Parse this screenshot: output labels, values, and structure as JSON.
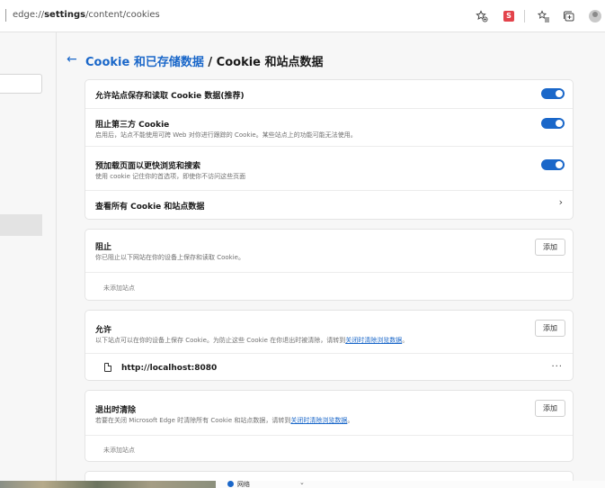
{
  "address_bar": {
    "url_prefix": "edge://",
    "url_bold": "settings",
    "url_rest": "/content/cookies",
    "ext_badge": "S"
  },
  "header": {
    "back_arrow": "←",
    "title_link": "Cookie 和已存储数据",
    "title_sep": " / ",
    "title_current": "Cookie 和站点数据"
  },
  "settings": {
    "allow_save_label": "允许站点保存和读取 Cookie 数据(推荐)",
    "block_third_label": "阻止第三方 Cookie",
    "block_third_desc": "启用后，站点不能使用可跨 Web 对你进行跟踪的 Cookie。某些站点上的功能可能无法使用。",
    "preload_label": "预加载页面以更快浏览和搜索",
    "preload_desc": "使用 cookie 记住你的首选项，即使你不访问这些页面",
    "see_all_label": "查看所有 Cookie 和站点数据",
    "chevron": "›"
  },
  "block_section": {
    "title": "阻止",
    "desc": "你已阻止以下网站在你的设备上保存和读取 Cookie。",
    "add": "添加",
    "empty": "未添加站点"
  },
  "allow_section": {
    "title": "允许",
    "desc_prefix": "以下站点可以在你的设备上保存 Cookie。为防止这些 Cookie 在你退出时被清除，请转到",
    "desc_link": "关闭时清除浏览数据",
    "desc_suffix": "。",
    "add": "添加",
    "site": "http://localhost:8080",
    "more": "···"
  },
  "clear_section": {
    "title": "退出时清除",
    "desc_prefix": "若要在关闭 Microsoft Edge 时清除所有 Cookie 和站点数据，请转到",
    "desc_link": "关闭时清除浏览数据",
    "desc_suffix": "。",
    "add": "添加",
    "empty": "未添加站点"
  },
  "taskbar": {
    "label": "网络",
    "caret": "⌄"
  },
  "colors": {
    "accent": "#1a67c9",
    "ext_red": "#e3434b"
  }
}
